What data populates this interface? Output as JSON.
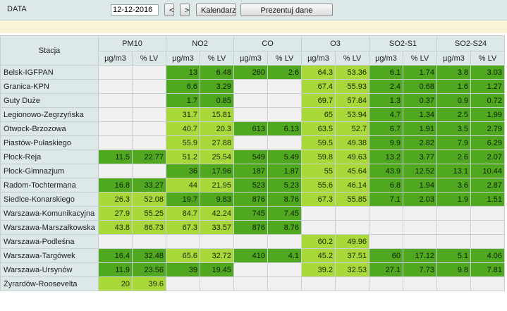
{
  "toolbar": {
    "label": "DATA",
    "date_value": "12-12-2016",
    "prev_label": "<",
    "next_label": ">",
    "calendar_label": "Kalendarz",
    "present_label": "Prezentuj dane"
  },
  "colors": {
    "header_bg": "#dde8e8",
    "very_good": "#4fa820",
    "good": "#a8d83a",
    "empty": "#f0f0f0",
    "band": "#faf4d6"
  },
  "table": {
    "station_header": "Stacja",
    "groups": [
      "PM10",
      "NO2",
      "CO",
      "O3",
      "SO2-S1",
      "SO2-S24"
    ],
    "units": [
      "µg/m3",
      "% LV"
    ],
    "rows": [
      {
        "station": "Belsk-IGFPAN",
        "cells": [
          null,
          null,
          {
            "v": "13",
            "c": "g1"
          },
          {
            "v": "6.48",
            "c": "g1"
          },
          {
            "v": "260",
            "c": "g1"
          },
          {
            "v": "2.6",
            "c": "g1"
          },
          {
            "v": "64.3",
            "c": "g2"
          },
          {
            "v": "53.36",
            "c": "g2"
          },
          {
            "v": "6.1",
            "c": "g1"
          },
          {
            "v": "1.74",
            "c": "g1"
          },
          {
            "v": "3.8",
            "c": "g1"
          },
          {
            "v": "3.03",
            "c": "g1"
          }
        ]
      },
      {
        "station": "Granica-KPN",
        "cells": [
          null,
          null,
          {
            "v": "6.6",
            "c": "g1"
          },
          {
            "v": "3.29",
            "c": "g1"
          },
          null,
          null,
          {
            "v": "67.4",
            "c": "g2"
          },
          {
            "v": "55.93",
            "c": "g2"
          },
          {
            "v": "2.4",
            "c": "g1"
          },
          {
            "v": "0.68",
            "c": "g1"
          },
          {
            "v": "1.6",
            "c": "g1"
          },
          {
            "v": "1.27",
            "c": "g1"
          }
        ]
      },
      {
        "station": "Guty Duże",
        "cells": [
          null,
          null,
          {
            "v": "1.7",
            "c": "g1"
          },
          {
            "v": "0.85",
            "c": "g1"
          },
          null,
          null,
          {
            "v": "69.7",
            "c": "g2"
          },
          {
            "v": "57.84",
            "c": "g2"
          },
          {
            "v": "1.3",
            "c": "g1"
          },
          {
            "v": "0.37",
            "c": "g1"
          },
          {
            "v": "0.9",
            "c": "g1"
          },
          {
            "v": "0.72",
            "c": "g1"
          }
        ]
      },
      {
        "station": "Legionowo-Zegrzyńska",
        "cells": [
          null,
          null,
          {
            "v": "31.7",
            "c": "g2"
          },
          {
            "v": "15.81",
            "c": "g2"
          },
          null,
          null,
          {
            "v": "65",
            "c": "g2"
          },
          {
            "v": "53.94",
            "c": "g2"
          },
          {
            "v": "4.7",
            "c": "g1"
          },
          {
            "v": "1.34",
            "c": "g1"
          },
          {
            "v": "2.5",
            "c": "g1"
          },
          {
            "v": "1.99",
            "c": "g1"
          }
        ]
      },
      {
        "station": "Otwock-Brzozowa",
        "cells": [
          null,
          null,
          {
            "v": "40.7",
            "c": "g2"
          },
          {
            "v": "20.3",
            "c": "g2"
          },
          {
            "v": "613",
            "c": "g1"
          },
          {
            "v": "6.13",
            "c": "g1"
          },
          {
            "v": "63.5",
            "c": "g2"
          },
          {
            "v": "52.7",
            "c": "g2"
          },
          {
            "v": "6.7",
            "c": "g1"
          },
          {
            "v": "1.91",
            "c": "g1"
          },
          {
            "v": "3.5",
            "c": "g1"
          },
          {
            "v": "2.79",
            "c": "g1"
          }
        ]
      },
      {
        "station": "Piastów-Pułaskiego",
        "cells": [
          null,
          null,
          {
            "v": "55.9",
            "c": "g2"
          },
          {
            "v": "27.88",
            "c": "g2"
          },
          null,
          null,
          {
            "v": "59.5",
            "c": "g2"
          },
          {
            "v": "49.38",
            "c": "g2"
          },
          {
            "v": "9.9",
            "c": "g1"
          },
          {
            "v": "2.82",
            "c": "g1"
          },
          {
            "v": "7.9",
            "c": "g1"
          },
          {
            "v": "6.29",
            "c": "g1"
          }
        ]
      },
      {
        "station": "Płock-Reja",
        "cells": [
          {
            "v": "11.5",
            "c": "g1"
          },
          {
            "v": "22.77",
            "c": "g1"
          },
          {
            "v": "51.2",
            "c": "g2"
          },
          {
            "v": "25.54",
            "c": "g2"
          },
          {
            "v": "549",
            "c": "g1"
          },
          {
            "v": "5.49",
            "c": "g1"
          },
          {
            "v": "59.8",
            "c": "g2"
          },
          {
            "v": "49.63",
            "c": "g2"
          },
          {
            "v": "13.2",
            "c": "g1"
          },
          {
            "v": "3.77",
            "c": "g1"
          },
          {
            "v": "2.6",
            "c": "g1"
          },
          {
            "v": "2.07",
            "c": "g1"
          }
        ]
      },
      {
        "station": "Płock-Gimnazjum",
        "cells": [
          null,
          null,
          {
            "v": "36",
            "c": "g1"
          },
          {
            "v": "17.96",
            "c": "g1"
          },
          {
            "v": "187",
            "c": "g1"
          },
          {
            "v": "1.87",
            "c": "g1"
          },
          {
            "v": "55",
            "c": "g2"
          },
          {
            "v": "45.64",
            "c": "g2"
          },
          {
            "v": "43.9",
            "c": "g1"
          },
          {
            "v": "12.52",
            "c": "g1"
          },
          {
            "v": "13.1",
            "c": "g1"
          },
          {
            "v": "10.44",
            "c": "g1"
          }
        ]
      },
      {
        "station": "Radom-Tochtermana",
        "cells": [
          {
            "v": "16.8",
            "c": "g1"
          },
          {
            "v": "33.27",
            "c": "g1"
          },
          {
            "v": "44",
            "c": "g2"
          },
          {
            "v": "21.95",
            "c": "g2"
          },
          {
            "v": "523",
            "c": "g1"
          },
          {
            "v": "5.23",
            "c": "g1"
          },
          {
            "v": "55.6",
            "c": "g2"
          },
          {
            "v": "46.14",
            "c": "g2"
          },
          {
            "v": "6.8",
            "c": "g1"
          },
          {
            "v": "1.94",
            "c": "g1"
          },
          {
            "v": "3.6",
            "c": "g1"
          },
          {
            "v": "2.87",
            "c": "g1"
          }
        ]
      },
      {
        "station": "Siedlce-Konarskiego",
        "cells": [
          {
            "v": "26.3",
            "c": "g2"
          },
          {
            "v": "52.08",
            "c": "g2"
          },
          {
            "v": "19.7",
            "c": "g1"
          },
          {
            "v": "9.83",
            "c": "g1"
          },
          {
            "v": "876",
            "c": "g1"
          },
          {
            "v": "8.76",
            "c": "g1"
          },
          {
            "v": "67.3",
            "c": "g2"
          },
          {
            "v": "55.85",
            "c": "g2"
          },
          {
            "v": "7.1",
            "c": "g1"
          },
          {
            "v": "2.03",
            "c": "g1"
          },
          {
            "v": "1.9",
            "c": "g1"
          },
          {
            "v": "1.51",
            "c": "g1"
          }
        ]
      },
      {
        "station": "Warszawa-Komunikacyjna",
        "cells": [
          {
            "v": "27.9",
            "c": "g2"
          },
          {
            "v": "55.25",
            "c": "g2"
          },
          {
            "v": "84.7",
            "c": "g2"
          },
          {
            "v": "42.24",
            "c": "g2"
          },
          {
            "v": "745",
            "c": "g1"
          },
          {
            "v": "7.45",
            "c": "g1"
          },
          null,
          null,
          null,
          null,
          null,
          null
        ]
      },
      {
        "station": "Warszawa-Marszałkowska",
        "cells": [
          {
            "v": "43.8",
            "c": "g2"
          },
          {
            "v": "86.73",
            "c": "g2"
          },
          {
            "v": "67.3",
            "c": "g2"
          },
          {
            "v": "33.57",
            "c": "g2"
          },
          {
            "v": "876",
            "c": "g1"
          },
          {
            "v": "8.76",
            "c": "g1"
          },
          null,
          null,
          null,
          null,
          null,
          null
        ]
      },
      {
        "station": "Warszawa-Podleśna",
        "cells": [
          null,
          null,
          null,
          null,
          null,
          null,
          {
            "v": "60.2",
            "c": "g2"
          },
          {
            "v": "49.96",
            "c": "g2"
          },
          null,
          null,
          null,
          null
        ]
      },
      {
        "station": "Warszawa-Targówek",
        "cells": [
          {
            "v": "16.4",
            "c": "g1"
          },
          {
            "v": "32.48",
            "c": "g1"
          },
          {
            "v": "65.6",
            "c": "g2"
          },
          {
            "v": "32.72",
            "c": "g2"
          },
          {
            "v": "410",
            "c": "g1"
          },
          {
            "v": "4.1",
            "c": "g1"
          },
          {
            "v": "45.2",
            "c": "g2"
          },
          {
            "v": "37.51",
            "c": "g2"
          },
          {
            "v": "60",
            "c": "g1"
          },
          {
            "v": "17.12",
            "c": "g1"
          },
          {
            "v": "5.1",
            "c": "g1"
          },
          {
            "v": "4.06",
            "c": "g1"
          }
        ]
      },
      {
        "station": "Warszawa-Ursynów",
        "cells": [
          {
            "v": "11.9",
            "c": "g1"
          },
          {
            "v": "23.56",
            "c": "g1"
          },
          {
            "v": "39",
            "c": "g1"
          },
          {
            "v": "19.45",
            "c": "g1"
          },
          null,
          null,
          {
            "v": "39.2",
            "c": "g2"
          },
          {
            "v": "32.53",
            "c": "g2"
          },
          {
            "v": "27.1",
            "c": "g1"
          },
          {
            "v": "7.73",
            "c": "g1"
          },
          {
            "v": "9.8",
            "c": "g1"
          },
          {
            "v": "7.81",
            "c": "g1"
          }
        ]
      },
      {
        "station": "Żyrardów-Roosevelta",
        "cells": [
          {
            "v": "20",
            "c": "g2"
          },
          {
            "v": "39.6",
            "c": "g2"
          },
          null,
          null,
          null,
          null,
          null,
          null,
          null,
          null,
          null,
          null
        ]
      }
    ]
  }
}
